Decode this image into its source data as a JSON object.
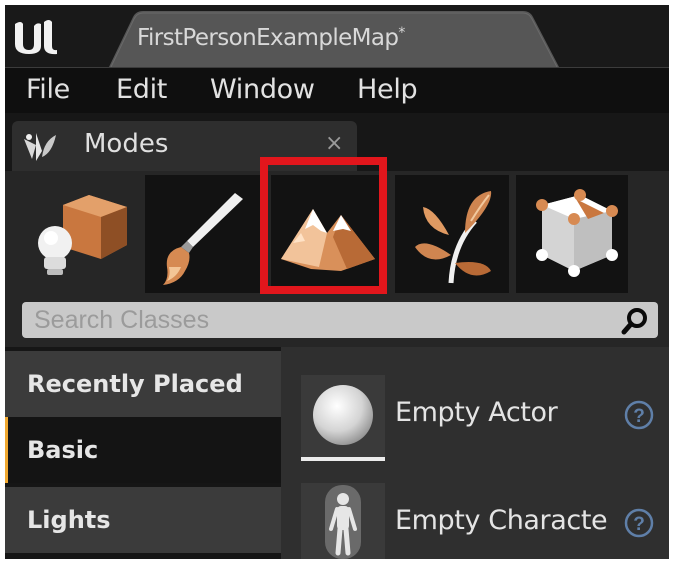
{
  "window": {
    "tab_title": "FirstPersonExampleMap",
    "modified_marker": "*"
  },
  "menu": {
    "items": [
      "File",
      "Edit",
      "Window",
      "Help"
    ]
  },
  "panel": {
    "tab_label": "Modes",
    "close_glyph": "×"
  },
  "modes": {
    "buttons": [
      {
        "name": "place-mode",
        "icon": "place-actor-icon"
      },
      {
        "name": "paint-mode",
        "icon": "paint-brush-icon"
      },
      {
        "name": "landscape-mode",
        "icon": "landscape-mountain-icon",
        "highlighted": true
      },
      {
        "name": "foliage-mode",
        "icon": "foliage-leaf-icon"
      },
      {
        "name": "geometry-mode",
        "icon": "geometry-cube-icon"
      }
    ],
    "highlight_color": "#e2161c"
  },
  "search": {
    "placeholder": "Search Classes",
    "value": ""
  },
  "categories": {
    "items": [
      "Recently Placed",
      "Basic",
      "Lights"
    ],
    "selected": "Basic",
    "accent_color": "#f0a830"
  },
  "place_items": [
    {
      "label": "Empty Actor",
      "icon": "sphere-icon"
    },
    {
      "label": "Empty Characte",
      "icon": "character-icon"
    }
  ],
  "help_glyph": "?"
}
